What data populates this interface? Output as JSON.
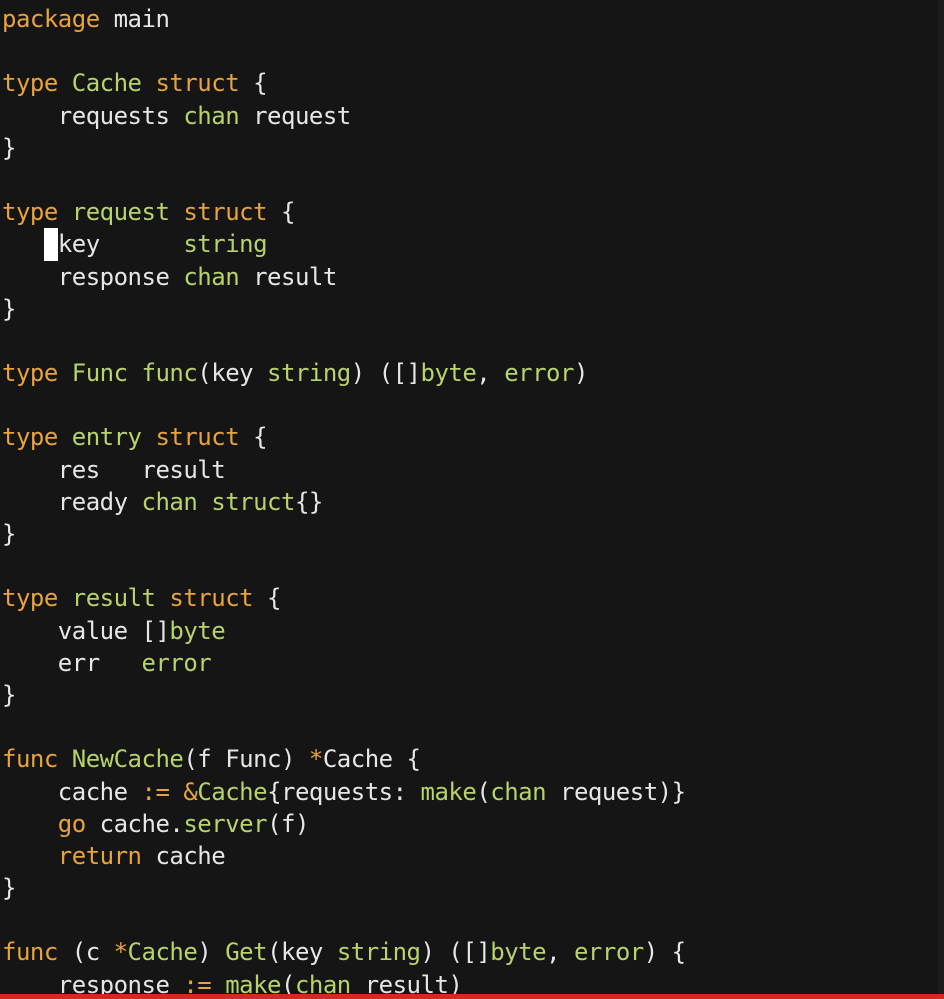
{
  "editor": {
    "colors": {
      "background": "#151515",
      "keyword": "#e8a33c",
      "type": "#b7d36b",
      "text": "#e6e6e6",
      "progress": "#d12a1f"
    },
    "lines": [
      [
        {
          "t": "package",
          "c": "kw"
        },
        {
          "t": " main",
          "c": "id"
        }
      ],
      [],
      [
        {
          "t": "type",
          "c": "kw"
        },
        {
          "t": " Cache ",
          "c": "ty"
        },
        {
          "t": "struct",
          "c": "kw"
        },
        {
          "t": " {",
          "c": "pun"
        }
      ],
      [
        {
          "t": "    requests ",
          "c": "id"
        },
        {
          "t": "chan",
          "c": "ty"
        },
        {
          "t": " request",
          "c": "id"
        }
      ],
      [
        {
          "t": "}",
          "c": "pun"
        }
      ],
      [],
      [
        {
          "t": "type",
          "c": "kw"
        },
        {
          "t": " request ",
          "c": "ty"
        },
        {
          "t": "struct",
          "c": "kw"
        },
        {
          "t": " {",
          "c": "pun"
        }
      ],
      [
        {
          "t": "   ",
          "c": "id"
        },
        {
          "t": " ",
          "c": "cursor"
        },
        {
          "t": "key      ",
          "c": "id"
        },
        {
          "t": "string",
          "c": "ty"
        }
      ],
      [
        {
          "t": "    response ",
          "c": "id"
        },
        {
          "t": "chan",
          "c": "ty"
        },
        {
          "t": " result",
          "c": "id"
        }
      ],
      [
        {
          "t": "}",
          "c": "pun"
        }
      ],
      [],
      [
        {
          "t": "type",
          "c": "kw"
        },
        {
          "t": " Func ",
          "c": "ty"
        },
        {
          "t": "func",
          "c": "fn"
        },
        {
          "t": "(key ",
          "c": "id"
        },
        {
          "t": "string",
          "c": "ty"
        },
        {
          "t": ") ([]",
          "c": "id"
        },
        {
          "t": "byte",
          "c": "ty"
        },
        {
          "t": ", ",
          "c": "id"
        },
        {
          "t": "error",
          "c": "ty"
        },
        {
          "t": ")",
          "c": "id"
        }
      ],
      [],
      [
        {
          "t": "type",
          "c": "kw"
        },
        {
          "t": " entry ",
          "c": "ty"
        },
        {
          "t": "struct",
          "c": "kw"
        },
        {
          "t": " {",
          "c": "pun"
        }
      ],
      [
        {
          "t": "    res   result",
          "c": "id"
        }
      ],
      [
        {
          "t": "    ready ",
          "c": "id"
        },
        {
          "t": "chan",
          "c": "ty"
        },
        {
          "t": " struct",
          "c": "ty"
        },
        {
          "t": "{}",
          "c": "id"
        }
      ],
      [
        {
          "t": "}",
          "c": "pun"
        }
      ],
      [],
      [
        {
          "t": "type",
          "c": "kw"
        },
        {
          "t": " result ",
          "c": "ty"
        },
        {
          "t": "struct",
          "c": "kw"
        },
        {
          "t": " {",
          "c": "pun"
        }
      ],
      [
        {
          "t": "    value []",
          "c": "id"
        },
        {
          "t": "byte",
          "c": "ty"
        }
      ],
      [
        {
          "t": "    err   ",
          "c": "id"
        },
        {
          "t": "error",
          "c": "ty"
        }
      ],
      [
        {
          "t": "}",
          "c": "pun"
        }
      ],
      [],
      [
        {
          "t": "func",
          "c": "kw"
        },
        {
          "t": " NewCache",
          "c": "fn"
        },
        {
          "t": "(f Func) ",
          "c": "id"
        },
        {
          "t": "*",
          "c": "op"
        },
        {
          "t": "Cache {",
          "c": "id"
        }
      ],
      [
        {
          "t": "    cache ",
          "c": "id"
        },
        {
          "t": ":=",
          "c": "op"
        },
        {
          "t": " ",
          "c": "id"
        },
        {
          "t": "&",
          "c": "op"
        },
        {
          "t": "Cache",
          "c": "ty"
        },
        {
          "t": "{requests: ",
          "c": "id"
        },
        {
          "t": "make",
          "c": "fn"
        },
        {
          "t": "(",
          "c": "id"
        },
        {
          "t": "chan",
          "c": "ty"
        },
        {
          "t": " request)}",
          "c": "id"
        }
      ],
      [
        {
          "t": "    ",
          "c": "id"
        },
        {
          "t": "go",
          "c": "kw"
        },
        {
          "t": " cache.",
          "c": "id"
        },
        {
          "t": "server",
          "c": "fn"
        },
        {
          "t": "(f)",
          "c": "id"
        }
      ],
      [
        {
          "t": "    ",
          "c": "id"
        },
        {
          "t": "return",
          "c": "kw"
        },
        {
          "t": " cache",
          "c": "id"
        }
      ],
      [
        {
          "t": "}",
          "c": "pun"
        }
      ],
      [],
      [
        {
          "t": "func",
          "c": "kw"
        },
        {
          "t": " (c ",
          "c": "id"
        },
        {
          "t": "*",
          "c": "op"
        },
        {
          "t": "Cache",
          "c": "ty"
        },
        {
          "t": ") ",
          "c": "id"
        },
        {
          "t": "Get",
          "c": "fn"
        },
        {
          "t": "(key ",
          "c": "id"
        },
        {
          "t": "string",
          "c": "ty"
        },
        {
          "t": ") ([]",
          "c": "id"
        },
        {
          "t": "byte",
          "c": "ty"
        },
        {
          "t": ", ",
          "c": "id"
        },
        {
          "t": "error",
          "c": "ty"
        },
        {
          "t": ") {",
          "c": "id"
        }
      ],
      [
        {
          "t": "    response ",
          "c": "id"
        },
        {
          "t": ":=",
          "c": "op"
        },
        {
          "t": " ",
          "c": "id"
        },
        {
          "t": "make",
          "c": "fn"
        },
        {
          "t": "(",
          "c": "id"
        },
        {
          "t": "chan",
          "c": "ty"
        },
        {
          "t": " result)",
          "c": "id"
        }
      ]
    ]
  }
}
